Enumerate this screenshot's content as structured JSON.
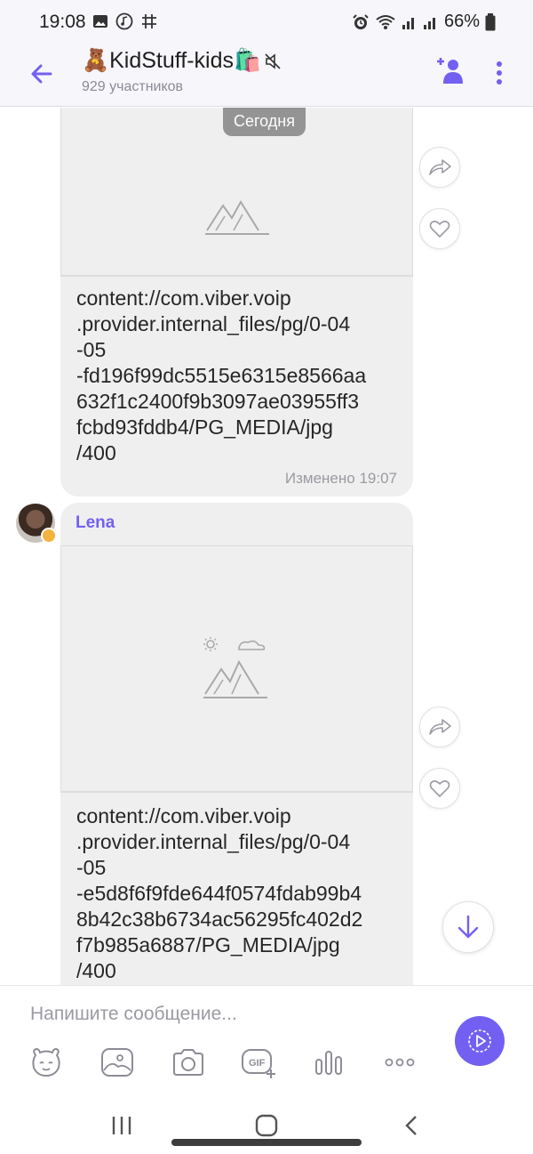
{
  "status_bar": {
    "time": "19:08",
    "battery": "66%"
  },
  "header": {
    "title": "🧸KidStuff-kids🛍️",
    "subtitle": "929 участников"
  },
  "chat": {
    "date_separator": "Сегодня",
    "messages": [
      {
        "text": "content://com.viber.voip\n.provider.internal_files/pg/0-04\n-05\n-fd196f99dc5515e6315e8566aa\n632f1c2400f9b3097ae03955ff3\nfcbd93fddb4/PG_MEDIA/jpg\n/400",
        "edited_label": "Изменено",
        "time": "19:07"
      },
      {
        "sender": "Lena",
        "text": "content://com.viber.voip\n.provider.internal_files/pg/0-04\n-05\n-e5d8f6f9fde644f0574fdab99b4\n8b42c38b6734ac56295fc402d2\nf7b985a6887/PG_MEDIA/jpg\n/400"
      }
    ]
  },
  "composer": {
    "placeholder": "Напишите сообщение..."
  },
  "colors": {
    "accent": "#7360f2",
    "bubble": "#efefef"
  }
}
